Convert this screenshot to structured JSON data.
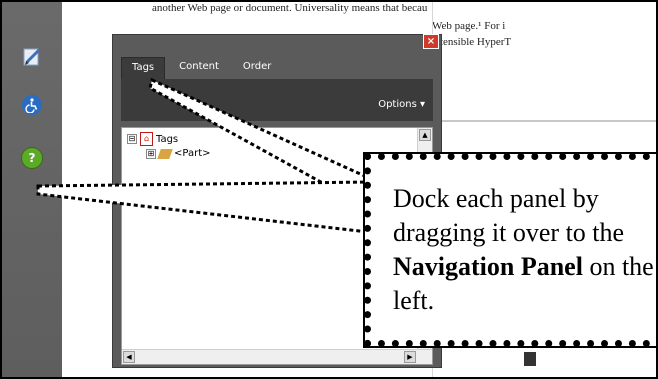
{
  "document": {
    "line1": "another Web page or document. Universality means that becau",
    "line2": "Web page.¹ For i",
    "line3": "Xtensible HyperT"
  },
  "panel": {
    "close_label": "×",
    "tabs": [
      "Tags",
      "Content",
      "Order"
    ],
    "options_label": "Options ▾",
    "tree": [
      {
        "expander": "⊟",
        "label": "Tags"
      },
      {
        "expander": "⊞",
        "label": "<Part>"
      }
    ]
  },
  "callout": {
    "part1": "Dock each panel by dragging it over to the ",
    "bold1": "Navigation Panel",
    "part2": " on the left."
  },
  "colors": {
    "nav_strip": "#5e5e5e",
    "panel_bg": "#5b5b5b",
    "panel_toolbar": "#3b3b3b",
    "accessibility_icon": "#2a6cc4",
    "help_icon": "#5cab28"
  },
  "icons": [
    "edit-icon",
    "accessibility-icon",
    "help-icon",
    "close-icon",
    "pdf-icon",
    "tag-icon"
  ]
}
